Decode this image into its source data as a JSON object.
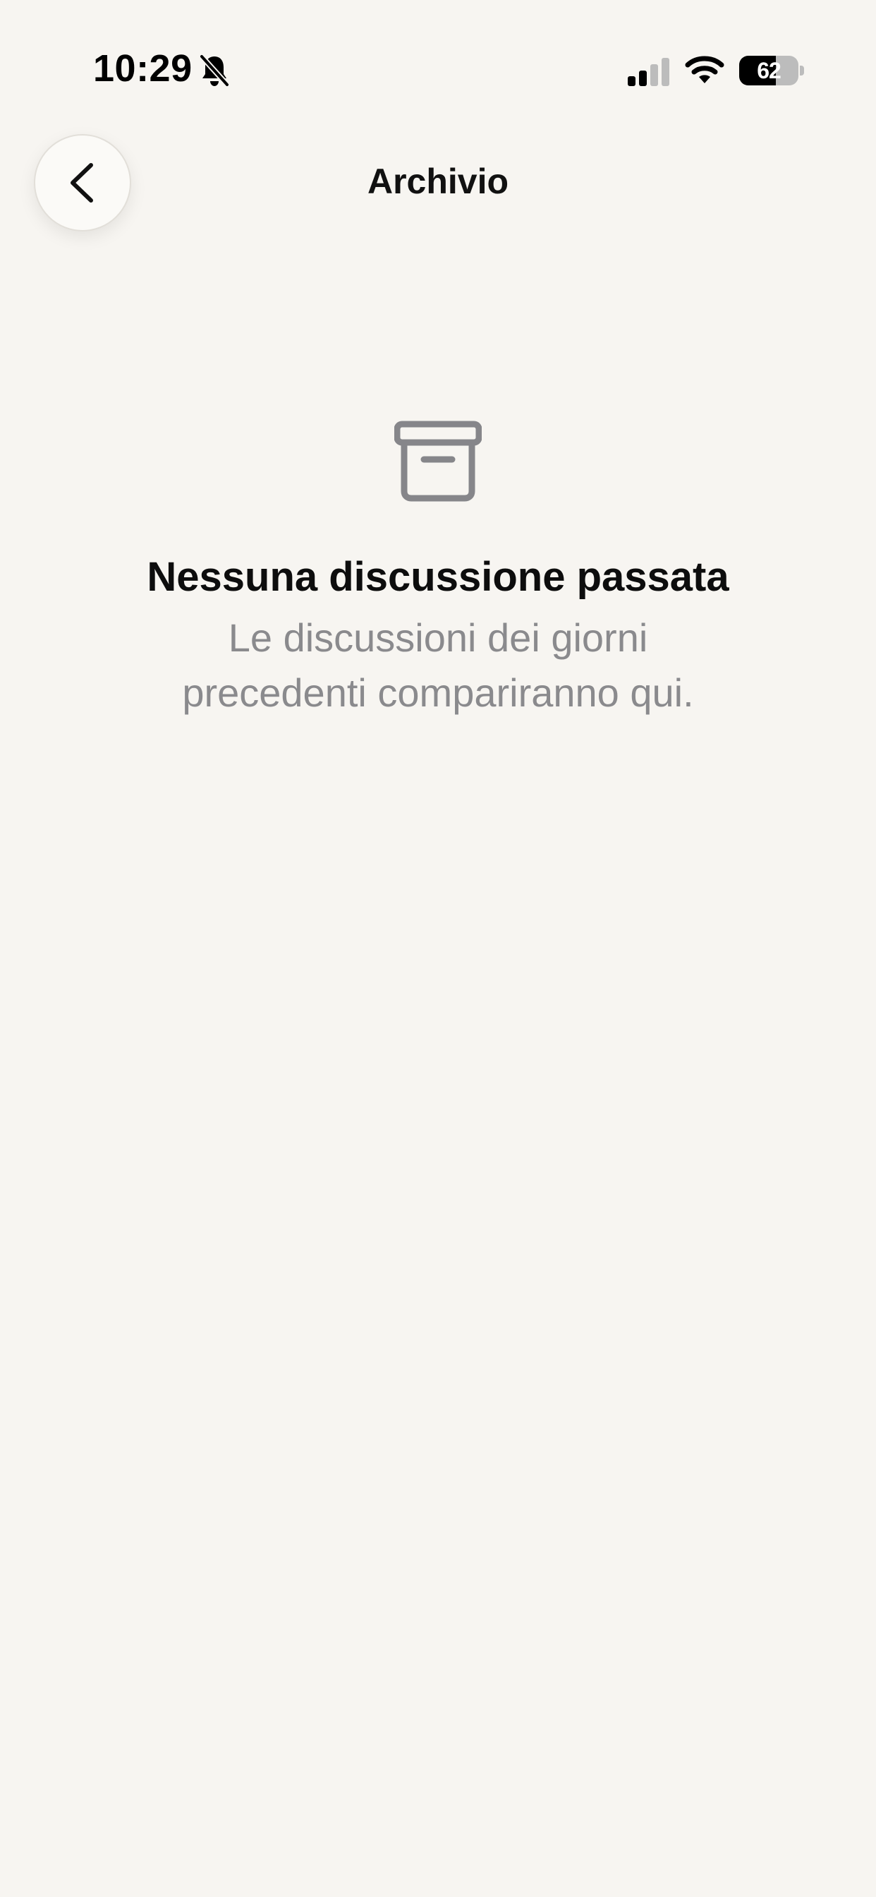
{
  "status_bar": {
    "time": "10:29",
    "battery_level": "62",
    "icons": [
      "bell-muted-icon",
      "signal-icon",
      "wifi-icon",
      "battery-icon"
    ]
  },
  "header": {
    "title": "Archivio",
    "back_icon": "chevron-left-icon"
  },
  "empty_state": {
    "icon": "archive-box-icon",
    "title": "Nessuna discussione passata",
    "subtitle": "Le discussioni dei giorni precedenti compariranno qui."
  },
  "colors": {
    "background": "#f7f5f1",
    "title_text": "#0d0d0d",
    "secondary_text": "#8a8a8d",
    "icon_gray": "#86868a"
  }
}
